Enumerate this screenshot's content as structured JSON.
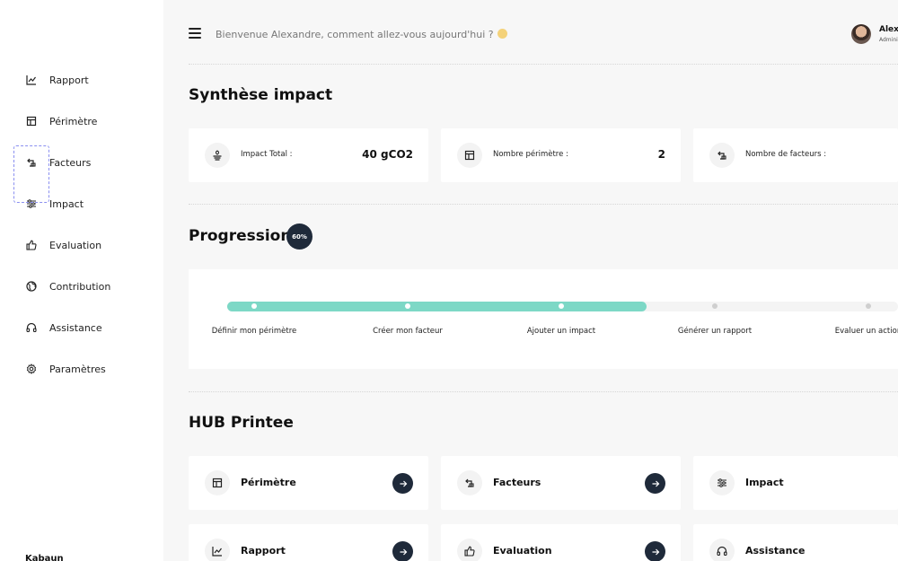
{
  "sidebar": {
    "items": [
      {
        "label": "Rapport",
        "icon": "chart-line-icon"
      },
      {
        "label": "Périmètre",
        "icon": "calendar-box-icon"
      },
      {
        "label": "Facteurs",
        "icon": "switch-arrow-icon"
      },
      {
        "label": "Impact",
        "icon": "sliders-icon"
      },
      {
        "label": "Evaluation",
        "icon": "thumbs-up-icon"
      },
      {
        "label": "Contribution",
        "icon": "globe-icon"
      },
      {
        "label": "Assistance",
        "icon": "headphones-icon"
      },
      {
        "label": "Paramètres",
        "icon": "gear-icon"
      }
    ],
    "brand": "Kabaun"
  },
  "header": {
    "welcome": "Bienvenue Alexandre, comment allez-vous aujourd'hui ?",
    "user_name": "Alexa",
    "user_role": "Admini"
  },
  "synthese": {
    "title": "Synthèse impact",
    "stats": [
      {
        "label": "Impact Total :",
        "value": "40 gCO2",
        "icon": "leaf-stack-icon"
      },
      {
        "label": "Nombre périmètre :",
        "value": "2",
        "icon": "calendar-box-icon"
      },
      {
        "label": "Nombre de facteurs :",
        "value": "",
        "icon": "switch-arrow-icon"
      }
    ]
  },
  "progression": {
    "title": "Progression",
    "badge": "60%",
    "percent": 60,
    "steps": [
      {
        "label": "Définir mon périmètre",
        "done": true
      },
      {
        "label": "Créer mon facteur",
        "done": true
      },
      {
        "label": "Ajouter un impact",
        "done": true
      },
      {
        "label": "Générer un rapport",
        "done": false
      },
      {
        "label": "Evaluer un action",
        "done": false
      }
    ]
  },
  "hub": {
    "title": "HUB Printee",
    "cards": [
      {
        "label": "Périmètre",
        "icon": "calendar-box-icon"
      },
      {
        "label": "Facteurs",
        "icon": "switch-arrow-icon"
      },
      {
        "label": "Impact",
        "icon": "sliders-icon"
      },
      {
        "label": "Rapport",
        "icon": "chart-line-icon"
      },
      {
        "label": "Evaluation",
        "icon": "thumbs-up-icon"
      },
      {
        "label": "Assistance",
        "icon": "headphones-icon"
      }
    ]
  },
  "colors": {
    "accent": "#7dd8c6",
    "dark": "#1f2a3a"
  }
}
